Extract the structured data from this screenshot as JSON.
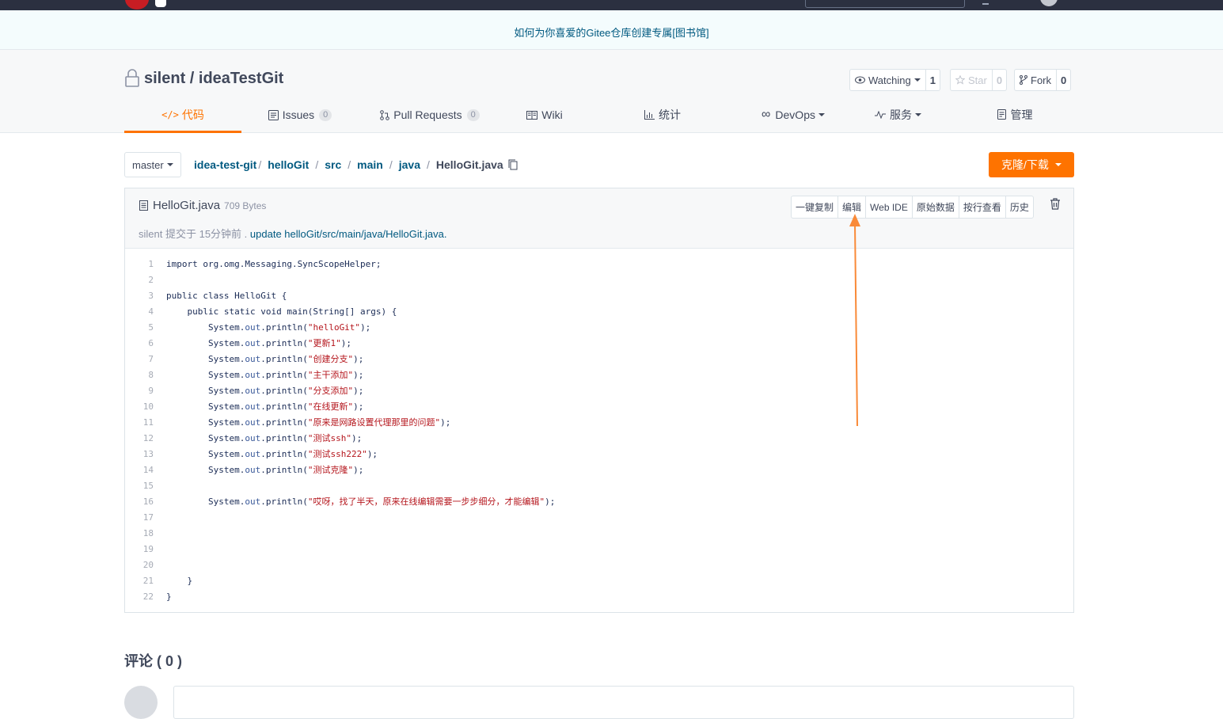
{
  "banner": {
    "text": "如何为你喜爱的Gitee仓库创建专属[图书馆]"
  },
  "repo": {
    "owner": "silent",
    "name": "ideaTestGit",
    "title": "silent / ideaTestGit"
  },
  "actions": {
    "watch_label": "Watching",
    "watch_count": "1",
    "star_label": "Star",
    "star_count": "0",
    "fork_label": "Fork",
    "fork_count": "0"
  },
  "tabs": [
    {
      "label": "代码",
      "icon": "code-icon",
      "active": true
    },
    {
      "label": "Issues",
      "badge": "0",
      "icon": "issues-icon"
    },
    {
      "label": "Pull Requests",
      "badge": "0",
      "icon": "pull-request-icon"
    },
    {
      "label": "Wiki",
      "icon": "wiki-icon"
    },
    {
      "label": "统计",
      "icon": "stats-icon"
    },
    {
      "label": "DevOps",
      "icon": "devops-icon",
      "dropdown": true
    },
    {
      "label": "服务",
      "icon": "service-icon",
      "dropdown": true
    },
    {
      "label": "管理",
      "icon": "manage-icon"
    }
  ],
  "branch": {
    "label": "master"
  },
  "breadcrumb": {
    "items": [
      "idea-test-git",
      "helloGit",
      "src",
      "main",
      "java"
    ],
    "current": "HelloGit.java",
    "sep": "/"
  },
  "clone_button": {
    "label": "克隆/下载"
  },
  "file": {
    "name": "HelloGit.java",
    "size": "709 Bytes",
    "commit_author": "silent",
    "commit_text": "提交于 15分钟前 .",
    "commit_message": "update helloGit/src/main/java/HelloGit.java."
  },
  "file_buttons": [
    "一键复制",
    "编辑",
    "Web IDE",
    "原始数据",
    "按行查看",
    "历史"
  ],
  "code_lines": [
    "import org.omg.Messaging.SyncScopeHelper;",
    "",
    "public class HelloGit {",
    "    public static void main(String[] args) {",
    "        System.out.println(\"helloGit\");",
    "        System.out.println(\"更新1\");",
    "        System.out.println(\"创建分支\");",
    "        System.out.println(\"主干添加\");",
    "        System.out.println(\"分支添加\");",
    "        System.out.println(\"在线更新\");",
    "        System.out.println(\"原来是网路设置代理那里的问题\");",
    "        System.out.println(\"测试ssh\");",
    "        System.out.println(\"测试ssh222\");",
    "        System.out.println(\"测试克隆\");",
    "",
    "        System.out.println(\"哎呀，找了半天，原来在线编辑需要一步步细分，才能编辑\");",
    "",
    "",
    "",
    "",
    "    }",
    "}"
  ],
  "comments": {
    "title": "评论 ( 0 )"
  },
  "colors": {
    "accent": "#fe7300",
    "link": "#005980",
    "arrow": "#f98a38",
    "topbar": "#2b3040"
  }
}
